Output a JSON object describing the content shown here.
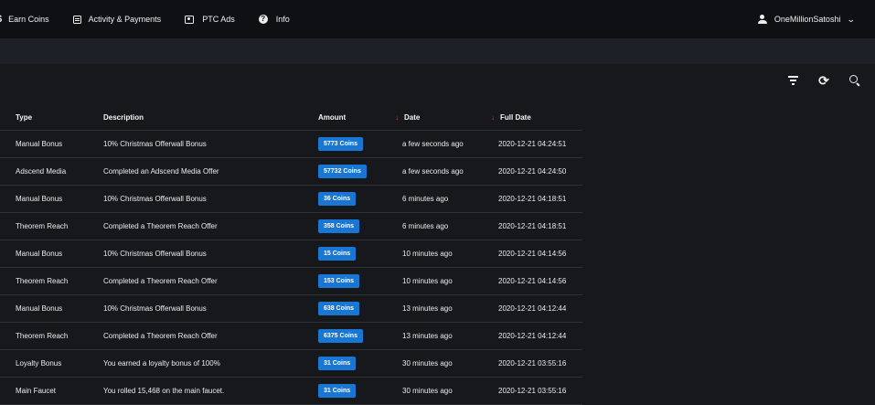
{
  "nav": {
    "earn": "Earn Coins",
    "activity": "Activity & Payments",
    "ptc": "PTC Ads",
    "info": "Info",
    "user": "OneMillionSatoshi"
  },
  "table": {
    "headers": {
      "type": "Type",
      "description": "Description",
      "amount": "Amount",
      "date": "Date",
      "full_date": "Full Date"
    },
    "rows": [
      {
        "type": "Manual Bonus",
        "description": "10% Christmas Offerwall Bonus",
        "amount": "5773 Coins",
        "date": "a few seconds ago",
        "full_date": "2020-12-21 04:24:51"
      },
      {
        "type": "Adscend Media",
        "description": "Completed an Adscend Media Offer",
        "amount": "57732 Coins",
        "date": "a few seconds ago",
        "full_date": "2020-12-21 04:24:50"
      },
      {
        "type": "Manual Bonus",
        "description": "10% Christmas Offerwall Bonus",
        "amount": "36 Coins",
        "date": "6 minutes ago",
        "full_date": "2020-12-21 04:18:51"
      },
      {
        "type": "Theorem Reach",
        "description": "Completed a Theorem Reach Offer",
        "amount": "358 Coins",
        "date": "6 minutes ago",
        "full_date": "2020-12-21 04:18:51"
      },
      {
        "type": "Manual Bonus",
        "description": "10% Christmas Offerwall Bonus",
        "amount": "15 Coins",
        "date": "10 minutes ago",
        "full_date": "2020-12-21 04:14:56"
      },
      {
        "type": "Theorem Reach",
        "description": "Completed a Theorem Reach Offer",
        "amount": "153 Coins",
        "date": "10 minutes ago",
        "full_date": "2020-12-21 04:14:56"
      },
      {
        "type": "Manual Bonus",
        "description": "10% Christmas Offerwall Bonus",
        "amount": "638 Coins",
        "date": "13 minutes ago",
        "full_date": "2020-12-21 04:12:44"
      },
      {
        "type": "Theorem Reach",
        "description": "Completed a Theorem Reach Offer",
        "amount": "6375 Coins",
        "date": "13 minutes ago",
        "full_date": "2020-12-21 04:12:44"
      },
      {
        "type": "Loyalty Bonus",
        "description": "You earned a loyalty bonus of 100%",
        "amount": "31 Coins",
        "date": "30 minutes ago",
        "full_date": "2020-12-21 03:55:16"
      },
      {
        "type": "Main Faucet",
        "description": "You rolled 15,468 on the main faucet.",
        "amount": "31 Coins",
        "date": "30 minutes ago",
        "full_date": "2020-12-21 03:55:16"
      }
    ]
  },
  "colors": {
    "accent": "#1976d2",
    "sort_arrow": "#e23b3b",
    "background": "#17181c",
    "topbar": "#0f1013"
  },
  "icons": [
    "dollar-icon",
    "list-icon",
    "ad-icon",
    "info-icon",
    "user-icon",
    "chevron-down-icon",
    "filter-icon",
    "sync-icon",
    "search-icon",
    "sort-arrow-icon"
  ]
}
